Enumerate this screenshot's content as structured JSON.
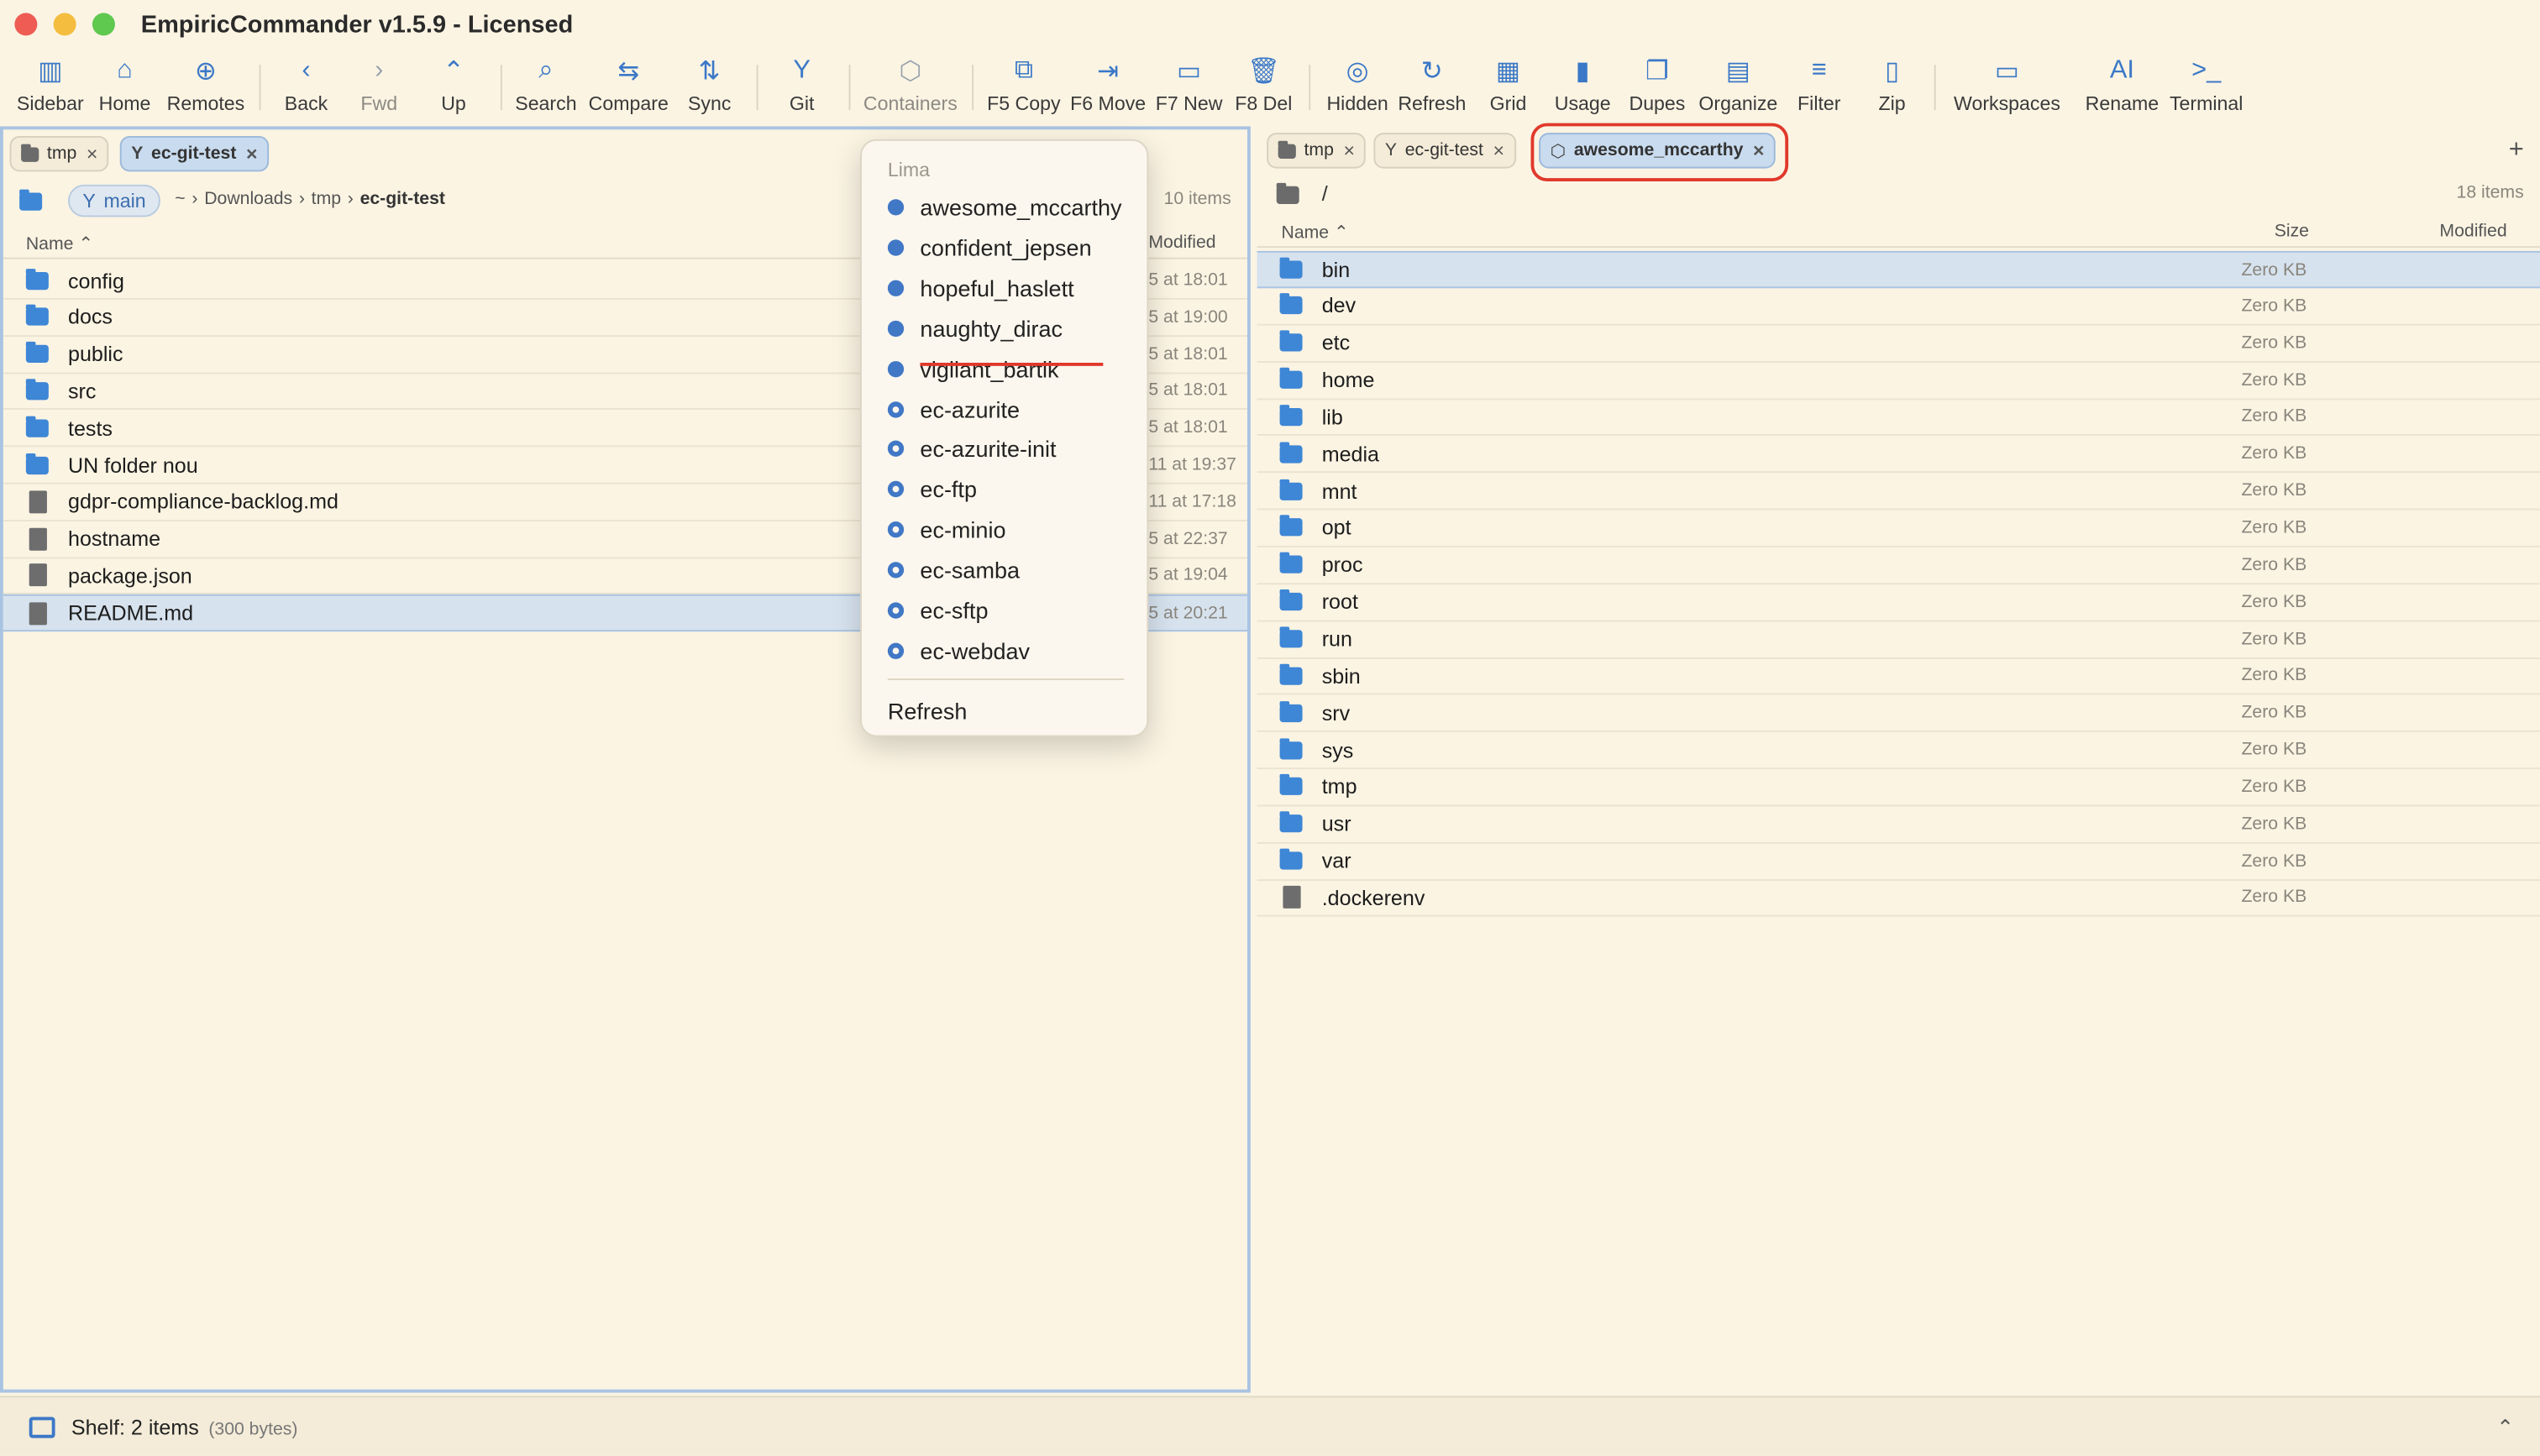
{
  "window": {
    "title": "EmpiricCommander v1.5.9 - Licensed"
  },
  "toolbar": [
    {
      "label": "Sidebar",
      "icon": "sidebar-icon"
    },
    {
      "label": "Home",
      "icon": "home-icon"
    },
    {
      "label": "Remotes",
      "icon": "globe-icon"
    },
    {
      "label": "Back",
      "icon": "chevron-left-icon"
    },
    {
      "label": "Fwd",
      "icon": "chevron-right-icon"
    },
    {
      "label": "Up",
      "icon": "chevron-up-icon"
    },
    {
      "label": "Search",
      "icon": "search-icon"
    },
    {
      "label": "Compare",
      "icon": "compare-icon"
    },
    {
      "label": "Sync",
      "icon": "sync-icon"
    },
    {
      "label": "Git",
      "icon": "git-branch-icon"
    },
    {
      "label": "Containers",
      "icon": "cube-icon"
    },
    {
      "label": "F5 Copy",
      "icon": "copy-icon"
    },
    {
      "label": "F6 Move",
      "icon": "move-icon"
    },
    {
      "label": "F7 New",
      "icon": "new-folder-icon"
    },
    {
      "label": "F8 Del",
      "icon": "trash-icon"
    },
    {
      "label": "Hidden",
      "icon": "eye-slash-icon"
    },
    {
      "label": "Refresh",
      "icon": "refresh-icon"
    },
    {
      "label": "Grid",
      "icon": "grid-icon"
    },
    {
      "label": "Usage",
      "icon": "bar-chart-icon"
    },
    {
      "label": "Dupes",
      "icon": "duplicate-icon"
    },
    {
      "label": "Organize",
      "icon": "organize-icon"
    },
    {
      "label": "Filter",
      "icon": "filter-icon"
    },
    {
      "label": "Zip",
      "icon": "zip-icon"
    },
    {
      "label": "Workspaces",
      "icon": "workspaces-icon"
    },
    {
      "label": "Rename",
      "icon": "rename-icon"
    },
    {
      "label": "Terminal",
      "icon": "terminal-icon"
    }
  ],
  "left_pane": {
    "tabs": [
      {
        "label": "tmp",
        "icon": "folder-icon"
      },
      {
        "label": "ec-git-test",
        "icon": "git-branch-icon"
      }
    ],
    "branch": "main",
    "path": [
      "~",
      "Downloads",
      "tmp",
      "ec-git-test"
    ],
    "item_count": "10 items",
    "columns": {
      "name": "Name",
      "modified": "Modified"
    },
    "rows": [
      {
        "name": "config",
        "type": "folder",
        "modified": "5 at 18:01"
      },
      {
        "name": "docs",
        "type": "folder",
        "modified": "5 at 19:00"
      },
      {
        "name": "public",
        "type": "folder",
        "modified": "5 at 18:01"
      },
      {
        "name": "src",
        "type": "folder",
        "modified": "5 at 18:01"
      },
      {
        "name": "tests",
        "type": "folder",
        "modified": "5 at 18:01"
      },
      {
        "name": "UN folder nou",
        "type": "folder",
        "modified": "11 at 19:37"
      },
      {
        "name": "gdpr-compliance-backlog.md",
        "type": "file",
        "modified": "11 at 17:18"
      },
      {
        "name": "hostname",
        "type": "file",
        "modified": "5 at 22:37"
      },
      {
        "name": "package.json",
        "type": "file",
        "modified": "5 at 19:04"
      },
      {
        "name": "README.md",
        "type": "file",
        "modified": "5 at 20:21",
        "selected": true
      }
    ]
  },
  "container_menu": {
    "header": "Lima",
    "items": [
      {
        "label": "awesome_mccarthy",
        "running": true
      },
      {
        "label": "confident_jepsen",
        "running": true
      },
      {
        "label": "hopeful_haslett",
        "running": true
      },
      {
        "label": "naughty_dirac",
        "running": true
      },
      {
        "label": "vigilant_bartik",
        "running": true
      },
      {
        "label": "ec-azurite",
        "running": false
      },
      {
        "label": "ec-azurite-init",
        "running": false
      },
      {
        "label": "ec-ftp",
        "running": false
      },
      {
        "label": "ec-minio",
        "running": false
      },
      {
        "label": "ec-samba",
        "running": false
      },
      {
        "label": "ec-sftp",
        "running": false
      },
      {
        "label": "ec-webdav",
        "running": false
      }
    ],
    "refresh": "Refresh"
  },
  "right_pane": {
    "tabs": [
      {
        "label": "tmp",
        "icon": "folder-icon"
      },
      {
        "label": "ec-git-test",
        "icon": "git-branch-icon"
      },
      {
        "label": "awesome_mccarthy",
        "icon": "cube-icon"
      }
    ],
    "path": "/",
    "item_count": "18 items",
    "columns": {
      "name": "Name",
      "size": "Size",
      "modified": "Modified"
    },
    "rows": [
      {
        "name": "bin",
        "type": "folder",
        "size": "Zero KB",
        "selected": true
      },
      {
        "name": "dev",
        "type": "folder",
        "size": "Zero KB"
      },
      {
        "name": "etc",
        "type": "folder",
        "size": "Zero KB"
      },
      {
        "name": "home",
        "type": "folder",
        "size": "Zero KB"
      },
      {
        "name": "lib",
        "type": "folder",
        "size": "Zero KB"
      },
      {
        "name": "media",
        "type": "folder",
        "size": "Zero KB"
      },
      {
        "name": "mnt",
        "type": "folder",
        "size": "Zero KB"
      },
      {
        "name": "opt",
        "type": "folder",
        "size": "Zero KB"
      },
      {
        "name": "proc",
        "type": "folder",
        "size": "Zero KB"
      },
      {
        "name": "root",
        "type": "folder",
        "size": "Zero KB"
      },
      {
        "name": "run",
        "type": "folder",
        "size": "Zero KB"
      },
      {
        "name": "sbin",
        "type": "folder",
        "size": "Zero KB"
      },
      {
        "name": "srv",
        "type": "folder",
        "size": "Zero KB"
      },
      {
        "name": "sys",
        "type": "folder",
        "size": "Zero KB"
      },
      {
        "name": "tmp",
        "type": "folder",
        "size": "Zero KB"
      },
      {
        "name": "usr",
        "type": "folder",
        "size": "Zero KB"
      },
      {
        "name": "var",
        "type": "folder",
        "size": "Zero KB"
      },
      {
        "name": ".dockerenv",
        "type": "file",
        "size": "Zero KB"
      }
    ]
  },
  "status": {
    "shelf": "Shelf: 2 items",
    "shelf_size": "(300 bytes)"
  },
  "colors": {
    "accent": "#3b78c7",
    "background": "#fbf4e3",
    "selection": "#d6e2ee",
    "highlight": "#e0392b"
  }
}
